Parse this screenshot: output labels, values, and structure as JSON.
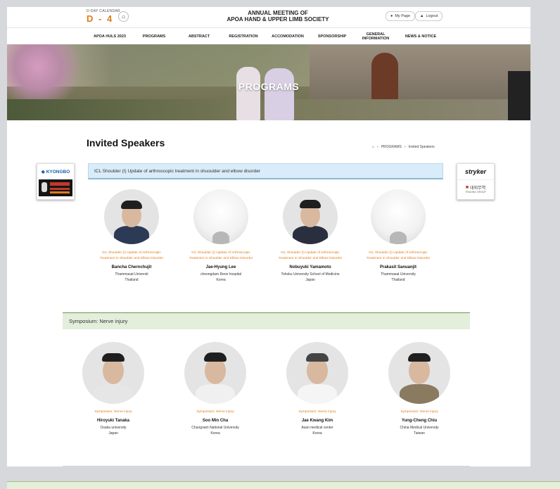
{
  "header": {
    "dday_caption": "D-DAY CALENDAR",
    "dday": "D - 4",
    "site_title_line1": "ANNUAL MEETING OF",
    "site_title_line2": "APOA HAND & UPPER LIMB SOCIETY",
    "mypage_label": "My Page",
    "logout_label": "Logout"
  },
  "nav": {
    "items": [
      "APOA HULS 2023",
      "PROGRAMS",
      "ABSTRACT",
      "REGISTRATION",
      "ACCOMODATION",
      "SPONSORSHIP",
      "GENERAL INFORMATION",
      "NEWS & NOTICE"
    ]
  },
  "hero": {
    "title": "PROGRAMS"
  },
  "page": {
    "title": "Invited Speakers",
    "breadcrumb": [
      "PROGRAMS",
      "Invited Speakers"
    ]
  },
  "sponsors": {
    "left_top": "KYONGBO",
    "right_top": "stryker",
    "right_bottom": "대외무역",
    "right_bottom_sub": "TRADING GROUP"
  },
  "section1": {
    "title": "ICL Shoulder (I) Update of arthroscopic treatment in shuoulder and elbow disorder",
    "speakers": [
      {
        "topic1": "ICL Shoulder (I) Update of Arthroscopic",
        "topic2": "Treatment in Shoulder and Elbow Disorder",
        "name": "Bancha Chernchujit",
        "aff1": "Thammasat Universit",
        "aff2": "Thailand"
      },
      {
        "topic1": "ICL Shoulder (I) Update of Arthroscopic",
        "topic2": "Treatment in Shoulder and Elbow Disorder",
        "name": "Jae-Hyung Lee",
        "aff1": "cheongdam Reon hospital",
        "aff2": "Korea"
      },
      {
        "topic1": "ICL Shoulder (I) Update of Arthroscopic",
        "topic2": "Treatment in Shoulder and Elbow Disorder",
        "name": "Nobuyuki Yamamoto",
        "aff1": "Tohoku University School of Medicine",
        "aff2": "Japan"
      },
      {
        "topic1": "ICL Shoulder (I) Update of Arthroscopic",
        "topic2": "Treatment in Shoulder and Elbow Disorder",
        "name": "Prakasit Sanuanjit",
        "aff1": "Thammasat University",
        "aff2": "Thailand"
      }
    ]
  },
  "section2": {
    "title": "Symposium: Nerve injury",
    "speakers": [
      {
        "topic": "Symposium: Nerve injury",
        "name": "Hiroyuki Tanaka",
        "aff1": "Osaka university",
        "aff2": "Japan"
      },
      {
        "topic": "Symposium: Nerve injury",
        "name": "Soo Min Cha",
        "aff1": "Chungnam National University",
        "aff2": "Korea"
      },
      {
        "topic": "Symposium: Nerve injury",
        "name": "Jae Kwang Kim",
        "aff1": "Asan medical center",
        "aff2": "Korea"
      },
      {
        "topic": "Symposium: Nerve injury",
        "name": "Yung-Cheng Chiu",
        "aff1": "China Medical University",
        "aff2": "Taiwan"
      }
    ]
  },
  "colors": {
    "accent_orange": "#e07b1a",
    "section1_bg": "#d9ecf9",
    "section2_bg": "#e3eedb"
  }
}
